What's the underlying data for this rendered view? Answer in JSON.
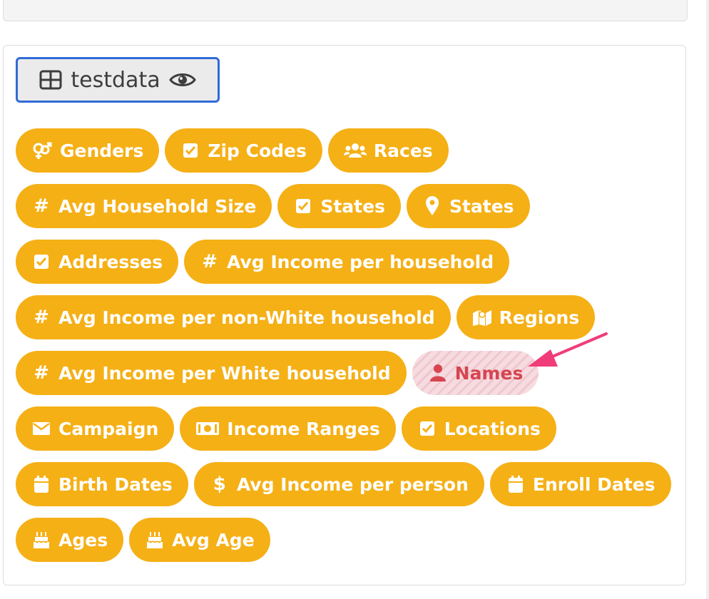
{
  "dataset": {
    "label": "testdata",
    "icon": "table-icon",
    "view_icon": "eye-icon"
  },
  "tags": [
    {
      "label": "Genders",
      "icon": "gender-icon"
    },
    {
      "label": "Zip Codes",
      "icon": "checkbox-icon"
    },
    {
      "label": "Races",
      "icon": "users-icon"
    },
    {
      "label": "Avg Household Size",
      "icon": "hash-icon",
      "glyph": "#"
    },
    {
      "label": "States",
      "icon": "checkbox-icon"
    },
    {
      "label": "States",
      "icon": "map-marker-icon"
    },
    {
      "label": "Addresses",
      "icon": "checkbox-icon"
    },
    {
      "label": "Avg Income per household",
      "icon": "hash-icon",
      "glyph": "#"
    },
    {
      "label": "Avg Income per non-White household",
      "icon": "hash-icon",
      "glyph": "#"
    },
    {
      "label": "Regions",
      "icon": "map-icon"
    },
    {
      "label": "Avg Income per White household",
      "icon": "hash-icon",
      "glyph": "#"
    },
    {
      "label": "Names",
      "icon": "user-icon",
      "state": "disabled"
    },
    {
      "label": "Campaign",
      "icon": "envelope-icon"
    },
    {
      "label": "Income Ranges",
      "icon": "money-bill-icon"
    },
    {
      "label": "Locations",
      "icon": "checkbox-icon"
    },
    {
      "label": "Birth Dates",
      "icon": "calendar-icon"
    },
    {
      "label": "Avg Income per person",
      "icon": "dollar-icon",
      "glyph": "$"
    },
    {
      "label": "Enroll Dates",
      "icon": "calendar-icon"
    },
    {
      "label": "Ages",
      "icon": "birthday-cake-icon"
    },
    {
      "label": "Avg Age",
      "icon": "birthday-cake-icon"
    }
  ],
  "colors": {
    "tag_bg": "#f5b016",
    "tag_text": "#ffffff",
    "disabled_text": "#d64550",
    "annotation_arrow": "#f03c78",
    "selected_border": "#2f6bd6"
  },
  "annotation": {
    "type": "arrow",
    "target": "Names"
  }
}
